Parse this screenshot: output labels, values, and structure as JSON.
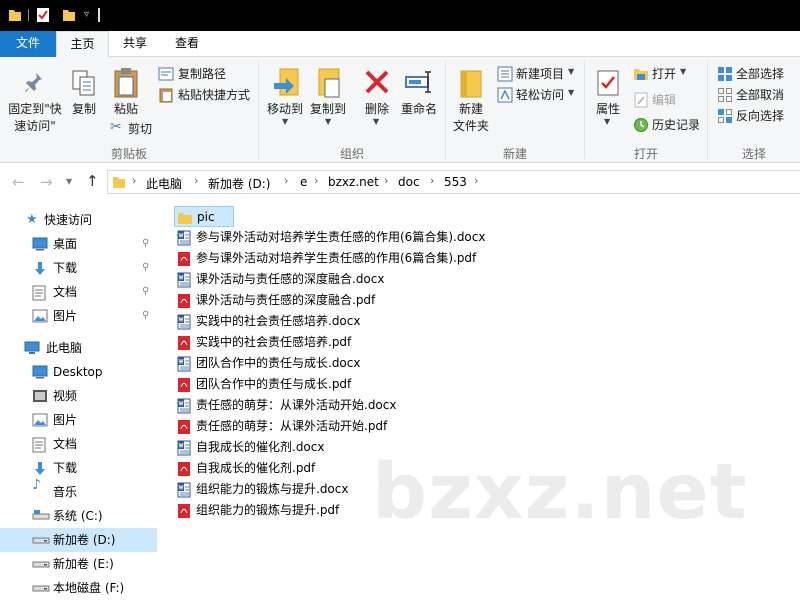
{
  "tabs": [
    "文件",
    "主页",
    "共享",
    "查看"
  ],
  "ribbon": {
    "clipboard": {
      "pin_label_line1": "固定到\"快",
      "pin_label_line2": "速访问\"",
      "copy": "复制",
      "paste": "粘贴",
      "copy_path": "复制路径",
      "paste_shortcut": "粘贴快捷方式",
      "cut": "剪切",
      "group": "剪贴板"
    },
    "organize": {
      "move_to": "移动到",
      "copy_to": "复制到",
      "delete": "删除",
      "rename": "重命名",
      "group": "组织"
    },
    "new": {
      "new_folder_line1": "新建",
      "new_folder_line2": "文件夹",
      "new_item": "新建项目",
      "easy_access": "轻松访问",
      "group": "新建"
    },
    "open": {
      "properties": "属性",
      "open": "打开",
      "edit": "编辑",
      "history": "历史记录",
      "group": "打开"
    },
    "select": {
      "select_all": "全部选择",
      "select_none": "全部取消",
      "invert": "反向选择",
      "group": "选择"
    }
  },
  "address": {
    "crumbs": [
      "此电脑",
      "新加卷 (D:)",
      "e",
      "bzxz.net",
      "doc",
      "553"
    ]
  },
  "nav": {
    "quick_access": "快速访问",
    "quick_items": [
      "桌面",
      "下载",
      "文档",
      "图片"
    ],
    "this_pc": "此电脑",
    "pc_items": [
      "Desktop",
      "视频",
      "图片",
      "文档",
      "下载",
      "音乐",
      "系统 (C:)",
      "新加卷 (D:)",
      "新加卷 (E:)",
      "本地磁盘 (F:)"
    ]
  },
  "files": [
    {
      "name": "pic",
      "type": "folder"
    },
    {
      "name": "参与课外活动对培养学生责任感的作用(6篇合集).docx",
      "type": "docx"
    },
    {
      "name": "参与课外活动对培养学生责任感的作用(6篇合集).pdf",
      "type": "pdf"
    },
    {
      "name": "课外活动与责任感的深度融合.docx",
      "type": "docx"
    },
    {
      "name": "课外活动与责任感的深度融合.pdf",
      "type": "pdf"
    },
    {
      "name": "实践中的社会责任感培养.docx",
      "type": "docx"
    },
    {
      "name": "实践中的社会责任感培养.pdf",
      "type": "pdf"
    },
    {
      "name": "团队合作中的责任与成长.docx",
      "type": "docx"
    },
    {
      "name": "团队合作中的责任与成长.pdf",
      "type": "pdf"
    },
    {
      "name": "责任感的萌芽：从课外活动开始.docx",
      "type": "docx"
    },
    {
      "name": "责任感的萌芽：从课外活动开始.pdf",
      "type": "pdf"
    },
    {
      "name": "自我成长的催化剂.docx",
      "type": "docx"
    },
    {
      "name": "自我成长的催化剂.pdf",
      "type": "pdf"
    },
    {
      "name": "组织能力的锻炼与提升.docx",
      "type": "docx"
    },
    {
      "name": "组织能力的锻炼与提升.pdf",
      "type": "pdf"
    }
  ],
  "watermark": "bzxz.net",
  "colors": {
    "accent": "#1979ca",
    "selection": "#cce8ff",
    "pdf_red": "#d9262c",
    "folder": "#f6c94a",
    "word_blue": "#2b579a"
  }
}
